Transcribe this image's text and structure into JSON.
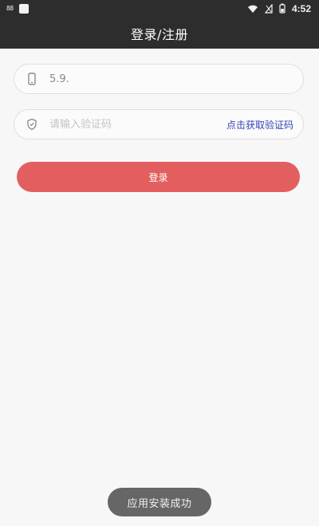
{
  "status_bar": {
    "indicator_text": "88",
    "time": "4:52",
    "icons": {
      "left_square": "app-square-icon",
      "wifi": "wifi-icon",
      "signal": "signal-icon",
      "battery": "battery-icon"
    }
  },
  "header": {
    "title": "登录/注册"
  },
  "form": {
    "phone": {
      "value": "5.9.",
      "placeholder": "",
      "icon": "phone-icon"
    },
    "verification_code": {
      "value": "",
      "placeholder": "请输入验证码",
      "icon": "shield-icon",
      "link_label": "点击获取验证码"
    },
    "login_label": "登录"
  },
  "toast": {
    "message": "应用安装成功"
  },
  "colors": {
    "status_bar": "#2d2d2d",
    "page_background": "#f7f7f8",
    "link": "#3446b6",
    "login_button": "#e35f5f",
    "toast": "#666666"
  }
}
